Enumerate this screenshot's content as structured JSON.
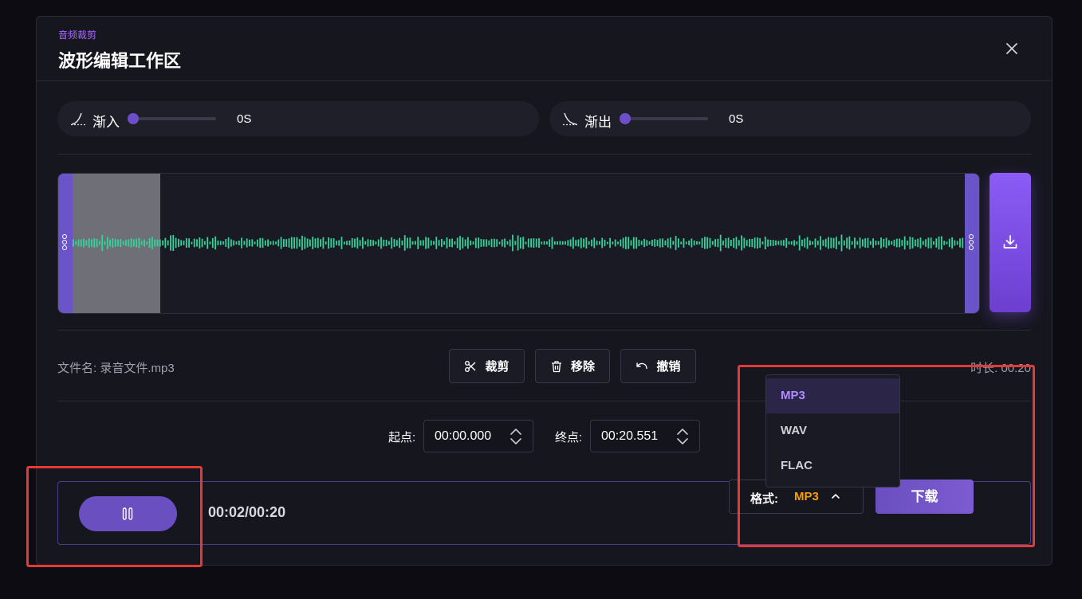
{
  "header": {
    "subtitle": "音频裁剪",
    "title": "波形编辑工作区"
  },
  "fade_in": {
    "label": "渐入",
    "value": "0S",
    "level": 0
  },
  "fade_out": {
    "label": "渐出",
    "value": "0S",
    "level": 0
  },
  "file": {
    "name_label": "文件名: 录音文件.mp3",
    "duration_label": "时长: 00:20"
  },
  "tools": {
    "cut": "裁剪",
    "remove": "移除",
    "undo": "撤销"
  },
  "range": {
    "start_label": "起点:",
    "start_value": "00:00.000",
    "end_label": "终点:",
    "end_value": "00:20.551"
  },
  "player": {
    "time": "00:02/00:20",
    "progress": 0.1
  },
  "format": {
    "label": "格式:",
    "current": "MP3",
    "options": [
      "MP3",
      "WAV",
      "FLAC"
    ]
  },
  "download_label": "下载",
  "colors": {
    "accent": "#6a4fc0",
    "wave": "#34d399",
    "format_value": "#f59e0b",
    "highlight": "#e53935"
  }
}
